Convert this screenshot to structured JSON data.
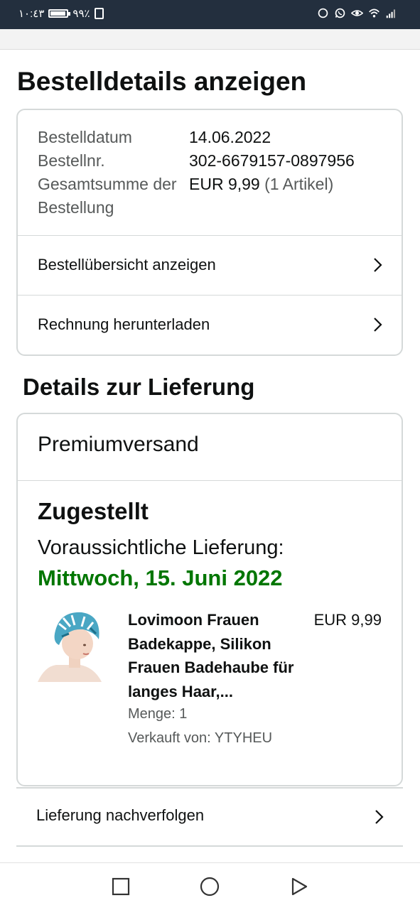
{
  "status_bar": {
    "time": "١٠:٤٣",
    "battery_percent": "٩٩٪"
  },
  "page": {
    "title": "Bestelldetails anzeigen"
  },
  "order_summary": {
    "rows": [
      {
        "label": "Bestelldatum",
        "value": "14.06.2022"
      },
      {
        "label": "Bestellnr.",
        "value": "302-6679157-0897956"
      },
      {
        "label": "Gesamtsumme der Bestellung",
        "value": "EUR 9,99",
        "note": "(1 Artikel)"
      }
    ],
    "links": [
      {
        "label": "Bestellübersicht anzeigen"
      },
      {
        "label": "Rechnung herunterladen"
      }
    ]
  },
  "delivery": {
    "heading": "Details zur Lieferung",
    "shipping_method": "Premiumversand",
    "status": "Zugestellt",
    "eta_label": "Voraussichtliche Lieferung:",
    "eta_date": "Mittwoch, 15. Juni 2022",
    "item": {
      "title": "Lovimoon Frauen Badekappe, Silikon Frauen Badehaube für langes Haar,...",
      "price": "EUR 9,99",
      "quantity": "Menge: 1",
      "seller": "Verkauft von: YTYHEU"
    },
    "track_link": "Lieferung nachverfolgen"
  },
  "colors": {
    "status_bar": "#232f3e",
    "eta_green": "#007600",
    "border": "#d5d9d9",
    "muted_text": "#565959"
  }
}
